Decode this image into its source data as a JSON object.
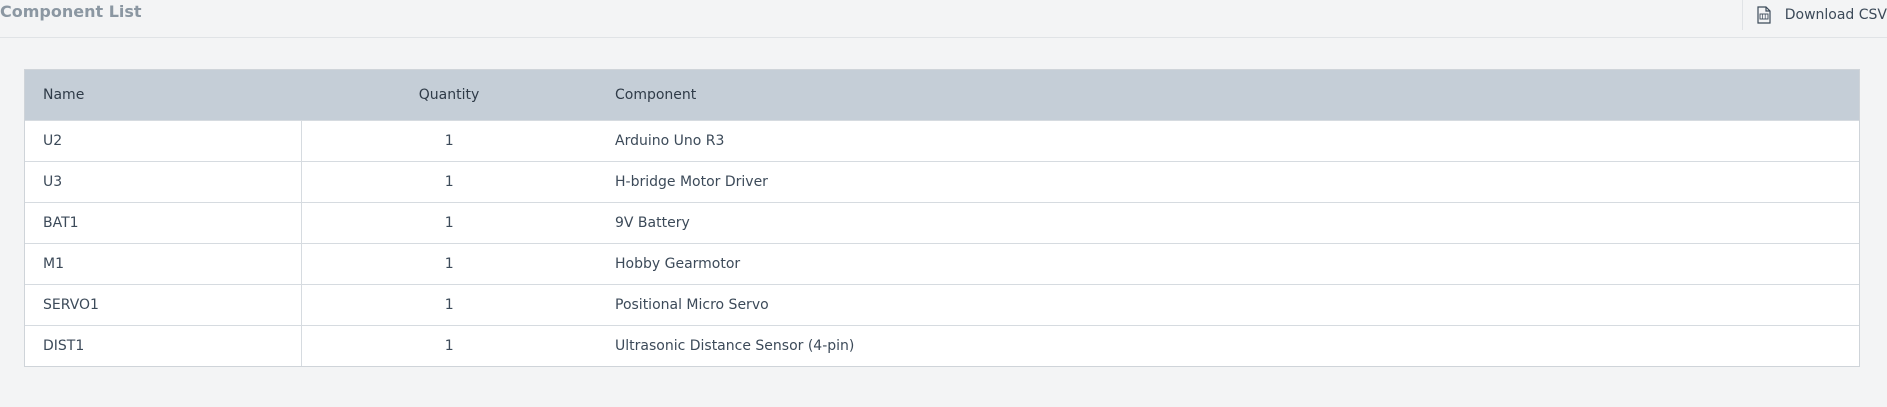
{
  "header": {
    "title": "Component List",
    "download_label": "Download CSV"
  },
  "table": {
    "columns": [
      "Name",
      "Quantity",
      "Component"
    ],
    "rows": [
      {
        "name": "U2",
        "quantity": "1",
        "component": "Arduino Uno R3"
      },
      {
        "name": "U3",
        "quantity": "1",
        "component": "H-bridge Motor Driver"
      },
      {
        "name": "BAT1",
        "quantity": "1",
        "component": "9V Battery"
      },
      {
        "name": "M1",
        "quantity": "1",
        "component": "Hobby Gearmotor"
      },
      {
        "name": "SERVO1",
        "quantity": "1",
        "component": "Positional Micro Servo"
      },
      {
        "name": "DIST1",
        "quantity": "1",
        "component": "Ultrasonic Distance Sensor (4-pin)"
      }
    ]
  },
  "icons": {
    "download": "csv-file-icon"
  },
  "colors": {
    "header_bg": "#c5ced7",
    "page_bg": "#f3f4f5",
    "text": "#3c4a59"
  }
}
